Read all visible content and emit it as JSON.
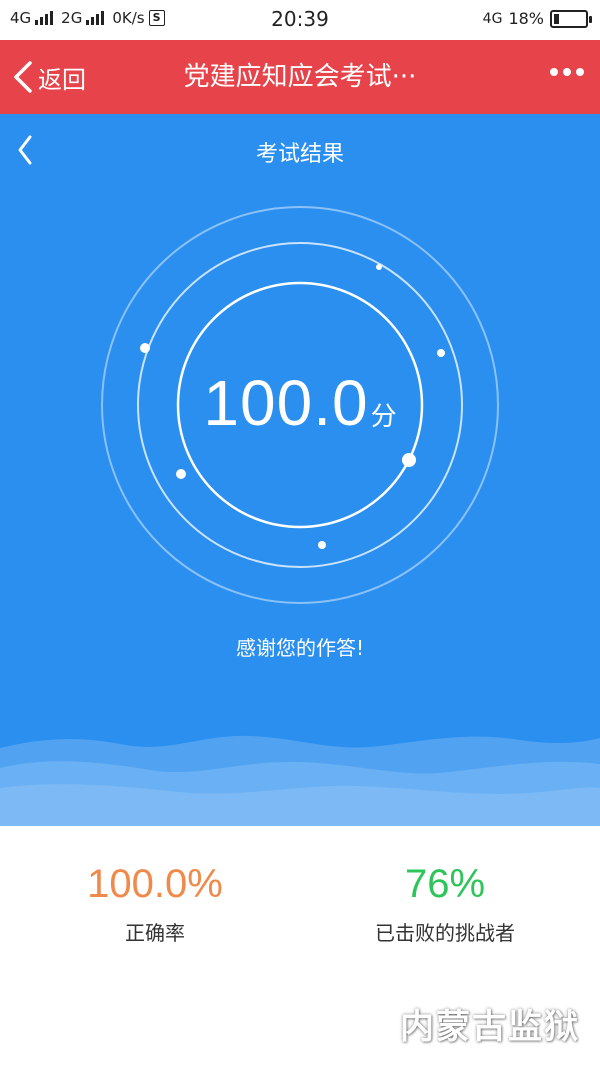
{
  "status_bar": {
    "network1": "4G",
    "network2": "2G",
    "speed": "0K/s",
    "app_icon": "S",
    "time": "20:39",
    "network_right": "4G",
    "battery": "18%",
    "battery_level": 0.18
  },
  "nav": {
    "back_label": "返回",
    "title": "党建应知应会考试···",
    "more_icon": "more-dots-icon"
  },
  "result": {
    "title": "考试结果",
    "score": "100.0",
    "score_unit": "分",
    "thanks": "感谢您的作答!"
  },
  "stats": {
    "accuracy_value": "100.0%",
    "accuracy_label": "正确率",
    "beaten_value": "76%",
    "beaten_label": "已击败的挑战者"
  },
  "watermark": "内蒙古监狱",
  "colors": {
    "navbar": "#e6434a",
    "hero_blue": "#2b8ff0",
    "accuracy": "#ef8a4a",
    "beaten": "#2ec45a"
  }
}
